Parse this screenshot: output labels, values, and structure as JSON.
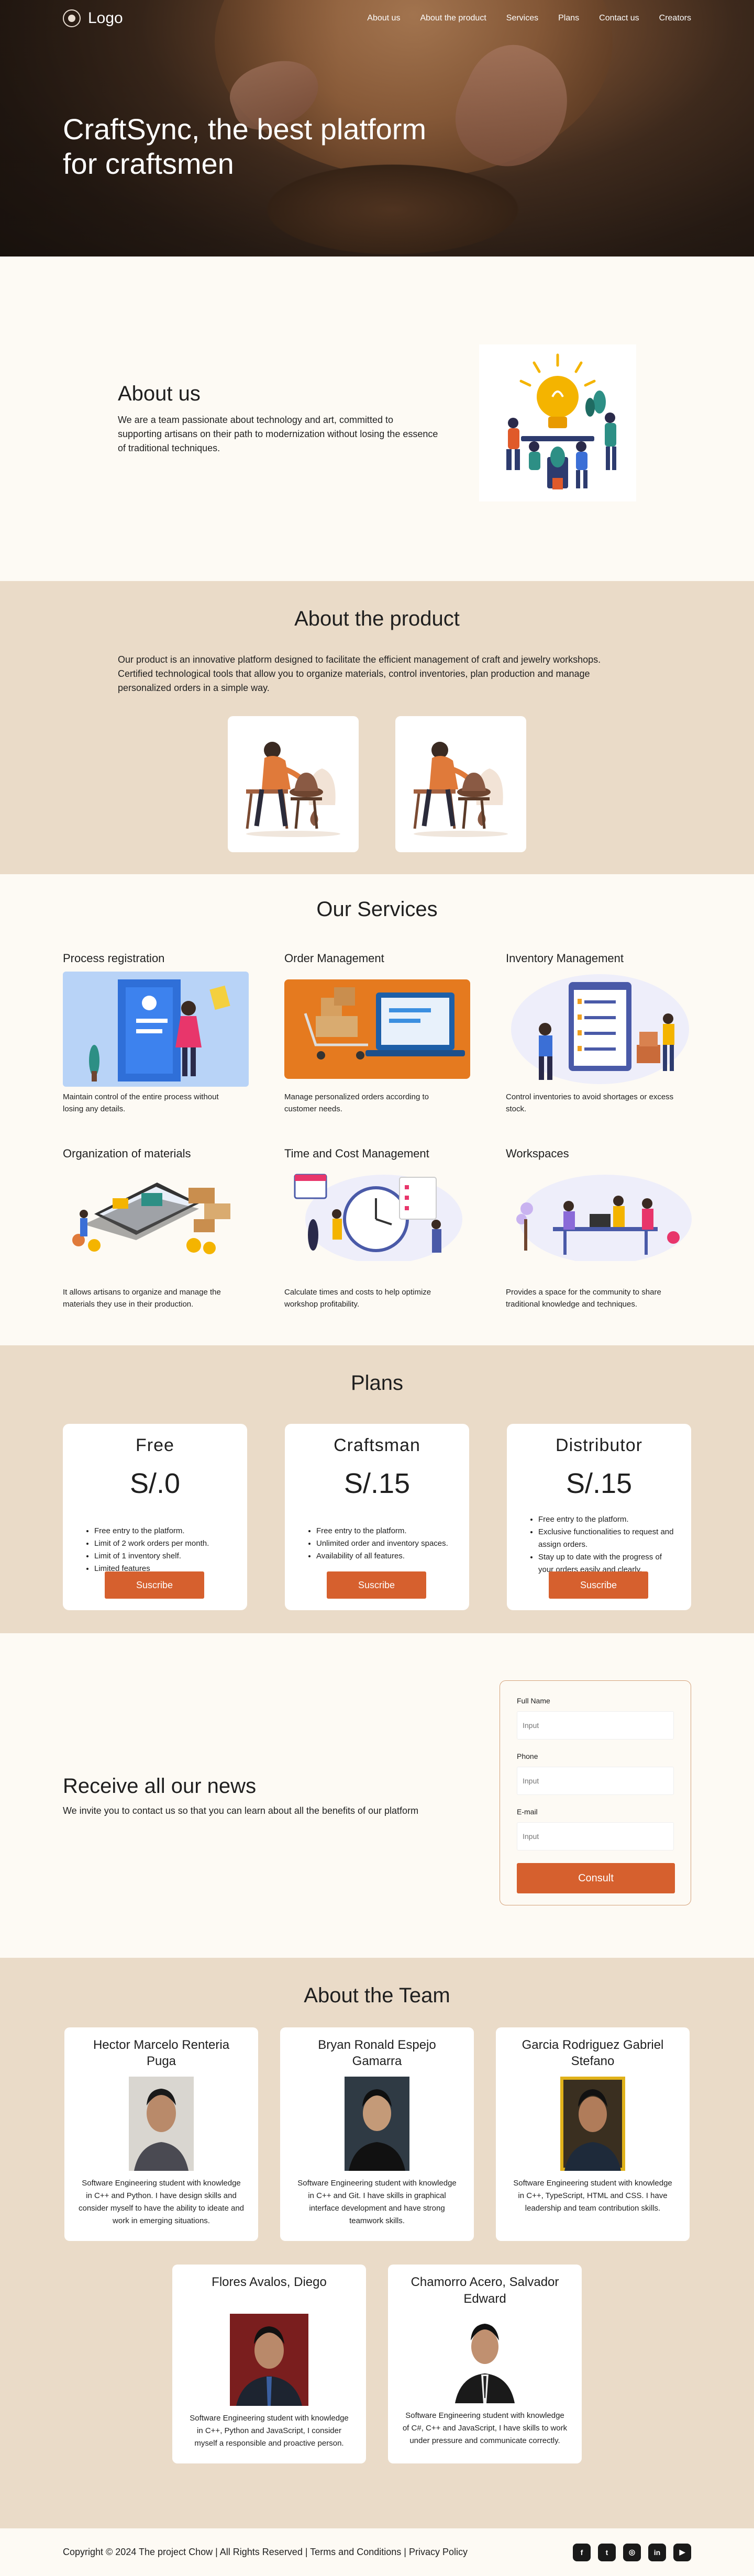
{
  "nav": {
    "logo": "Logo",
    "links": [
      "About us",
      "About the product",
      "Services",
      "Plans",
      "Contact us",
      "Creators"
    ]
  },
  "hero": {
    "title_line1": "CraftSync, the best platform",
    "title_line2": "for craftsmen"
  },
  "about": {
    "title": "About us",
    "text": "We are a team passionate about technology and art, committed to supporting artisans on their path to modernization without losing the essence of traditional techniques."
  },
  "product": {
    "title": "About the product",
    "text": "Our product is an innovative platform designed to facilitate the efficient management of craft and jewelry workshops. Certified technological tools that allow you to organize materials, control inventories, plan production and manage personalized orders in a simple way."
  },
  "services": {
    "title": "Our Services",
    "items": [
      {
        "title": "Process registration",
        "text": "Maintain control of the entire process without losing any details."
      },
      {
        "title": "Order Management",
        "text": "Manage personalized orders according to customer needs."
      },
      {
        "title": "Inventory Management",
        "text": "Control inventories to avoid shortages or excess stock."
      },
      {
        "title": "Organization of materials",
        "text": "It allows artisans to organize and manage the materials they use in their production."
      },
      {
        "title": "Time and Cost Management",
        "text": "Calculate times and costs to help optimize workshop profitability."
      },
      {
        "title": "Workspaces",
        "text": "Provides a space for the community to share traditional knowledge and techniques."
      }
    ]
  },
  "plans": {
    "title": "Plans",
    "button": "Suscribe",
    "items": [
      {
        "name": "Free",
        "price": "S/.0",
        "features": [
          "Free entry to the platform.",
          "Limit of 2 work orders per month.",
          "Limit of 1 inventory shelf.",
          "Limited features"
        ]
      },
      {
        "name": "Craftsman",
        "price": "S/.15",
        "features": [
          "Free entry to the platform.",
          "Unlimited order and inventory spaces.",
          "Availability of all features."
        ]
      },
      {
        "name": "Distributor",
        "price": "S/.15",
        "features": [
          "Free entry to the platform.",
          "Exclusive functionalities to request and assign orders.",
          "Stay up to date with the progress of your orders easily and clearly."
        ]
      }
    ]
  },
  "news": {
    "title": "Receive all our news",
    "text": "We invite you to contact us so that you can learn about all the benefits of our platform",
    "form": {
      "full_name_label": "Full Name",
      "phone_label": "Phone",
      "email_label": "E-mail",
      "placeholder": "Input",
      "button": "Consult"
    }
  },
  "team": {
    "title": "About the Team",
    "members": [
      {
        "name": "Hector Marcelo Renteria Puga",
        "bio": "Software Engineering student with knowledge in C++ and Python. I have design skills and consider myself to have the ability to ideate and work in emerging situations."
      },
      {
        "name": "Bryan Ronald Espejo Gamarra",
        "bio": "Software Engineering student with knowledge in C++ and Git. I have skills in graphical interface development and have strong teamwork skills."
      },
      {
        "name": "Garcia Rodriguez Gabriel Stefano",
        "bio": "Software Engineering student with knowledge in C++, TypeScript, HTML and CSS. I have leadership and team contribution skills."
      },
      {
        "name": "Flores Avalos, Diego",
        "bio": "Software Engineering student with knowledge in C++, Python and JavaScript, I consider myself a responsible and proactive person."
      },
      {
        "name": "Chamorro Acero, Salvador Edward",
        "bio": "Software Engineering student with knowledge of C#, C++ and JavaScript, I have skills to work under pressure and communicate correctly."
      }
    ]
  },
  "footer": {
    "text": "Copyright © 2024 The project Chow | All Rights Reserved | Terms and Conditions | Privacy Policy",
    "socials": [
      {
        "icon": "facebook-icon",
        "glyph": "f"
      },
      {
        "icon": "twitter-icon",
        "glyph": "t"
      },
      {
        "icon": "instagram-icon",
        "glyph": "◎"
      },
      {
        "icon": "linkedin-icon",
        "glyph": "in"
      },
      {
        "icon": "youtube-icon",
        "glyph": "▶"
      }
    ]
  },
  "colors": {
    "accent": "#d6602e",
    "sand": "#eadbc8",
    "cream": "#fdfaf4"
  }
}
